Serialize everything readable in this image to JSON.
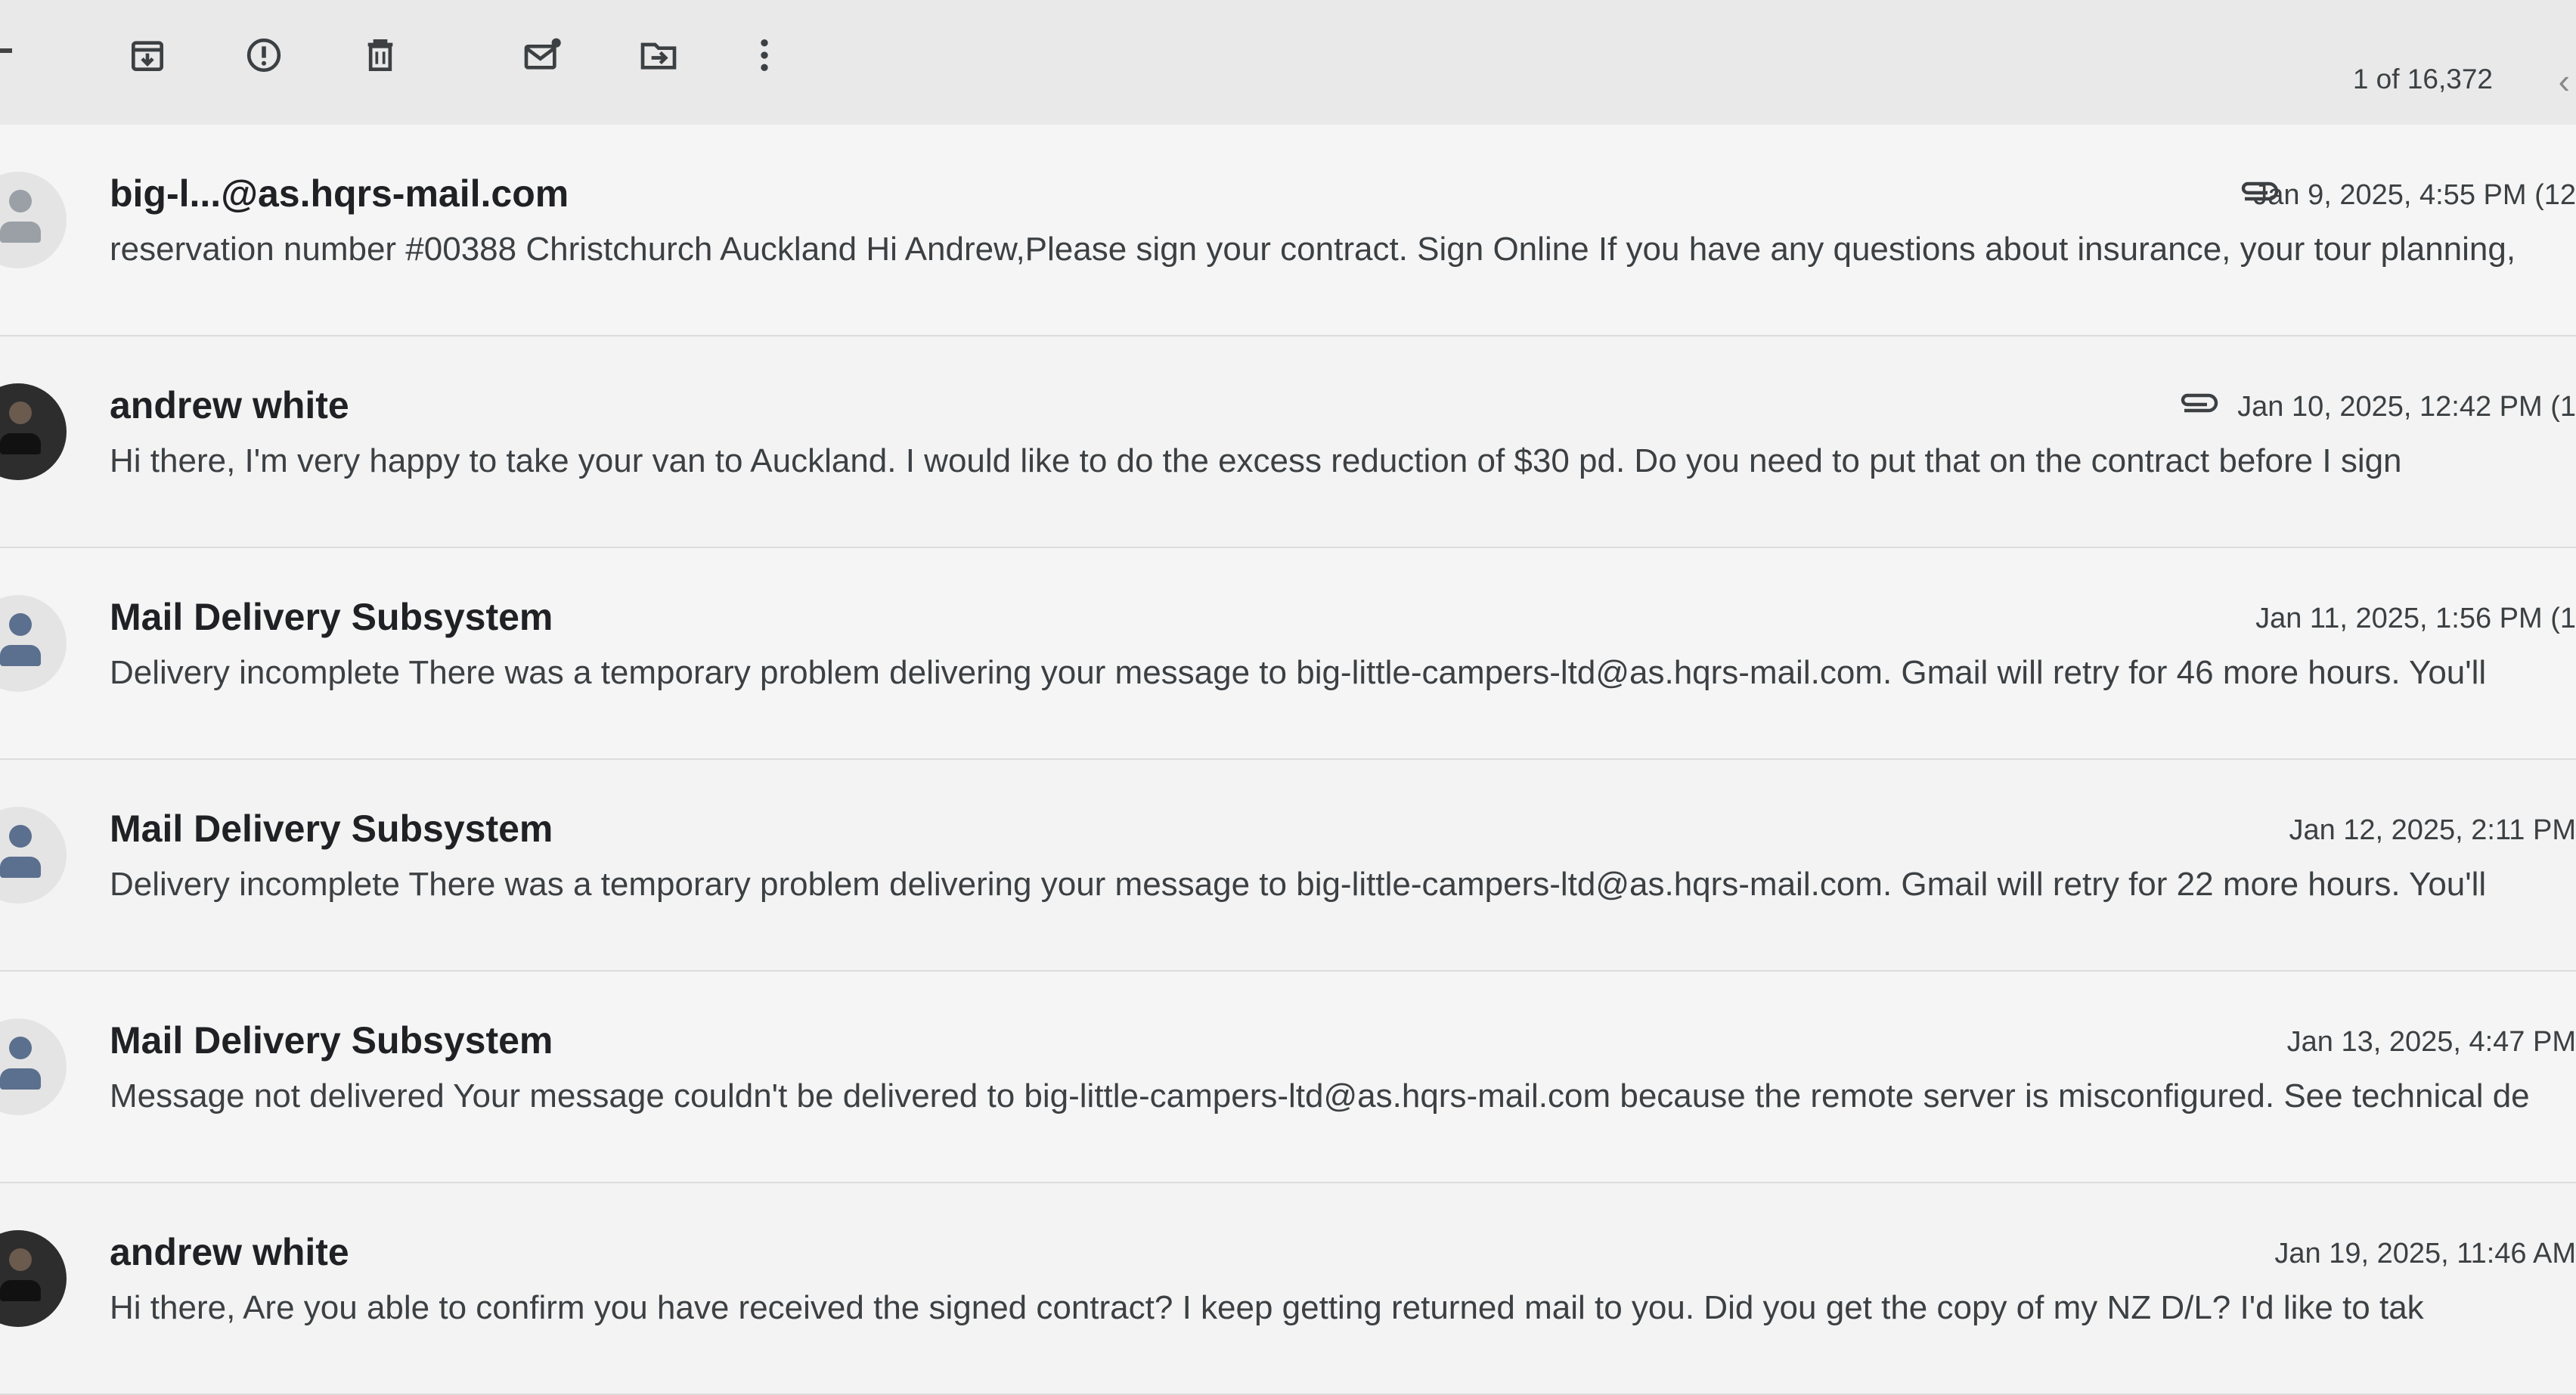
{
  "toolbar": {
    "buttons": [
      {
        "name": "archive-button",
        "icon": "archive-icon"
      },
      {
        "name": "report-spam-button",
        "icon": "report-spam-icon"
      },
      {
        "name": "delete-button",
        "icon": "trash-icon"
      },
      {
        "name": "mark-unread-button",
        "icon": "mark-unread-icon"
      },
      {
        "name": "move-to-button",
        "icon": "move-to-icon"
      },
      {
        "name": "more-button",
        "icon": "more-vertical-icon"
      }
    ],
    "pagination": "1 of 16,372",
    "prev_icon": "chevron-left-icon"
  },
  "emails": [
    {
      "sender": "big-l...@as.hqrs-mail.com",
      "snippet": "reservation number #00388 Christchurch Auckland Hi Andrew,Please sign your contract. Sign Online If you have any questions about insurance, your tour planning,",
      "date": "Jan 9, 2025, 4:55 PM (12",
      "attachment": true,
      "avatar": "generic-avatar"
    },
    {
      "sender": "andrew white",
      "snippet": "Hi there, I'm very happy to take your van to Auckland. I would like to do the excess reduction of $30 pd. Do you need to put that on the contract before I sign",
      "date": "Jan 10, 2025, 12:42 PM (1",
      "attachment": true,
      "avatar": "photo-avatar"
    },
    {
      "sender": "Mail Delivery Subsystem",
      "snippet": "Delivery incomplete There was a temporary problem delivering your message to big-little-campers-ltd@as.hqrs-mail.com. Gmail will retry for 46 more hours. You'll",
      "date": "Jan 11, 2025, 1:56 PM (1",
      "attachment": false,
      "avatar": "system-avatar"
    },
    {
      "sender": "Mail Delivery Subsystem",
      "snippet": "Delivery incomplete There was a temporary problem delivering your message to big-little-campers-ltd@as.hqrs-mail.com. Gmail will retry for 22 more hours. You'll",
      "date": "Jan 12, 2025, 2:11 PM",
      "attachment": false,
      "avatar": "system-avatar"
    },
    {
      "sender": "Mail Delivery Subsystem",
      "snippet": "Message not delivered Your message couldn't be delivered to big-little-campers-ltd@as.hqrs-mail.com because the remote server is misconfigured. See technical de",
      "date": "Jan 13, 2025, 4:47 PM",
      "attachment": false,
      "avatar": "system-avatar"
    },
    {
      "sender": "andrew white",
      "snippet": "Hi there, Are you able to confirm you have received the signed contract? I keep getting returned mail to you. Did you get the copy of my NZ D/L? I'd like to tak",
      "date": "Jan 19, 2025, 11:46 AM",
      "attachment": false,
      "avatar": "photo-avatar"
    }
  ]
}
